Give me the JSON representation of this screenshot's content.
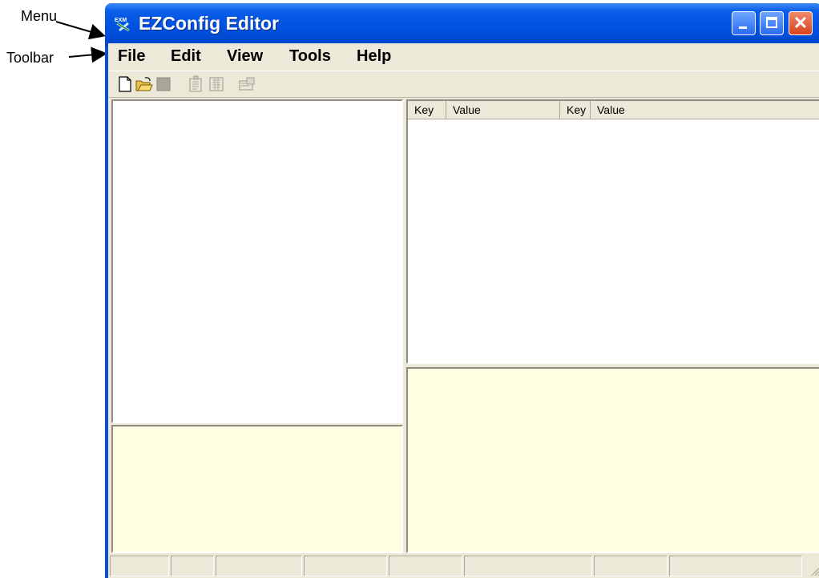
{
  "annotations": {
    "menu_label": "Menu",
    "toolbar_label": "Toolbar"
  },
  "window": {
    "title": "EZConfig Editor",
    "title_bar_color": "#0052e0",
    "controls": [
      "minimize-icon",
      "maximize-icon",
      "close-icon"
    ],
    "close_glyph": "✕"
  },
  "menu": {
    "items": [
      "File",
      "Edit",
      "View",
      "Tools",
      "Help"
    ]
  },
  "toolbar": {
    "buttons": [
      "new-icon",
      "open-icon",
      "save-icon",
      "properties-icon",
      "build-icon",
      "settings-icon"
    ]
  },
  "list": {
    "columns": [
      "Key",
      "Value",
      "Key",
      "Value"
    ]
  },
  "colors": {
    "info_panel_bg": "#fffee1",
    "chrome": "#ece9d8"
  }
}
